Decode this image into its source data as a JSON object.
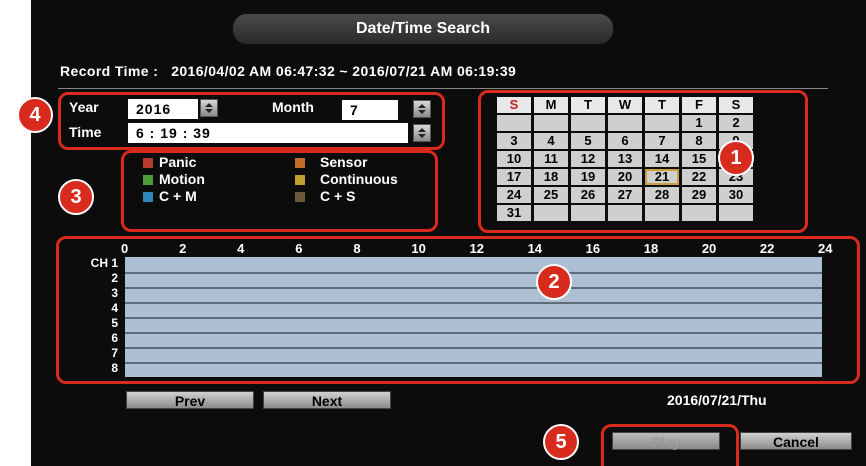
{
  "window": {
    "title": "Date/Time Search"
  },
  "record_time": {
    "label": "Record Time :",
    "value": "2016/04/02 AM 06:47:32 ~ 2016/07/21 AM 06:19:39"
  },
  "controls": {
    "year_label": "Year",
    "year_value": "2016",
    "month_label": "Month",
    "month_value": "7",
    "time_label": "Time",
    "time_value": "6 : 19 : 39"
  },
  "legend": [
    {
      "label": "Panic",
      "color": "#b83a2f"
    },
    {
      "label": "Sensor",
      "color": "#c46a2a"
    },
    {
      "label": "Motion",
      "color": "#4c9a3a"
    },
    {
      "label": "Continuous",
      "color": "#c0a030"
    },
    {
      "label": "C + M",
      "color": "#2f86b8"
    },
    {
      "label": "C + S",
      "color": "#6a5a3a"
    }
  ],
  "calendar": {
    "weekdays": [
      "S",
      "M",
      "T",
      "W",
      "T",
      "F",
      "S"
    ],
    "sunday_color": "#c42020",
    "selected_day": "21",
    "rows": [
      [
        "",
        "",
        "",
        "",
        "",
        "1",
        "2"
      ],
      [
        "3",
        "4",
        "5",
        "6",
        "7",
        "8",
        "9"
      ],
      [
        "10",
        "11",
        "12",
        "13",
        "14",
        "15",
        "16"
      ],
      [
        "17",
        "18",
        "19",
        "20",
        "21",
        "22",
        "23"
      ],
      [
        "24",
        "25",
        "26",
        "27",
        "28",
        "29",
        "30"
      ],
      [
        "31",
        "",
        "",
        "",
        "",
        "",
        ""
      ]
    ]
  },
  "timeline": {
    "hours": [
      "0",
      "2",
      "4",
      "6",
      "8",
      "10",
      "12",
      "14",
      "16",
      "18",
      "20",
      "22",
      "24"
    ],
    "channels": [
      "CH 1",
      "2",
      "3",
      "4",
      "5",
      "6",
      "7",
      "8"
    ],
    "bar_color": "#aebfd3"
  },
  "nav": {
    "prev_label": "Prev",
    "next_label": "Next",
    "date_display": "2016/07/21/Thu"
  },
  "actions": {
    "play_label": "Play",
    "cancel_label": "Cancel"
  },
  "callouts": [
    "1",
    "2",
    "3",
    "4",
    "5"
  ],
  "callout_color": "#d92a1e"
}
